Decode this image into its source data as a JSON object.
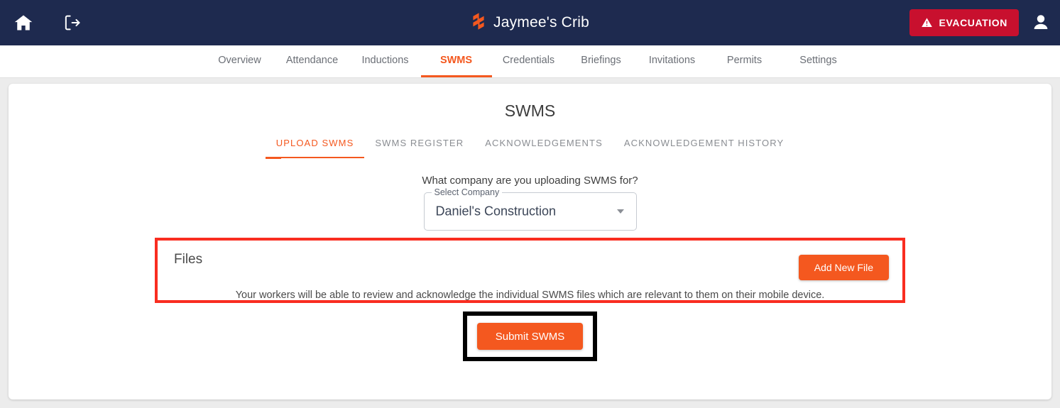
{
  "topbar": {
    "home_icon": "home-icon",
    "logout_icon": "logout-icon",
    "logo_icon": "brand-logo-icon",
    "title": "Jaymee's Crib",
    "evacuation_label": "EVACUATION",
    "evacuation_icon": "warning-triangle-icon",
    "account_icon": "account-avatar-icon",
    "bg_color": "#1e2a4f",
    "evacuation_color": "#c8102e"
  },
  "nav": {
    "tabs": [
      {
        "label": "Overview",
        "active": false
      },
      {
        "label": "Attendance",
        "active": false
      },
      {
        "label": "Inductions",
        "active": false
      },
      {
        "label": "SWMS",
        "active": true
      },
      {
        "label": "Credentials",
        "active": false
      },
      {
        "label": "Briefings",
        "active": false
      },
      {
        "label": "Invitations",
        "active": false
      },
      {
        "label": "Permits",
        "active": false
      },
      {
        "label": "Settings",
        "active": false
      }
    ],
    "accent_color": "#f4581f"
  },
  "main": {
    "page_title": "SWMS",
    "subtabs": [
      {
        "label": "UPLOAD SWMS",
        "active": true
      },
      {
        "label": "SWMS REGISTER",
        "active": false
      },
      {
        "label": "ACKNOWLEDGEMENTS",
        "active": false
      },
      {
        "label": "ACKNOWLEDGEMENT HISTORY",
        "active": false
      }
    ],
    "company": {
      "question": "What company are you uploading SWMS for?",
      "field_label": "Select Company",
      "value": "Daniel's Construction",
      "arrow_icon": "chevron-down-icon"
    },
    "files": {
      "title": "Files",
      "add_button": "Add New File",
      "hint": "Your workers will be able to review and acknowledge the individual SWMS files which are relevant to them on their mobile device.",
      "highlight_color": "#f92d20"
    },
    "submit": {
      "label": "Submit SWMS",
      "highlight_color": "#000000",
      "button_color": "#f4581f"
    }
  }
}
